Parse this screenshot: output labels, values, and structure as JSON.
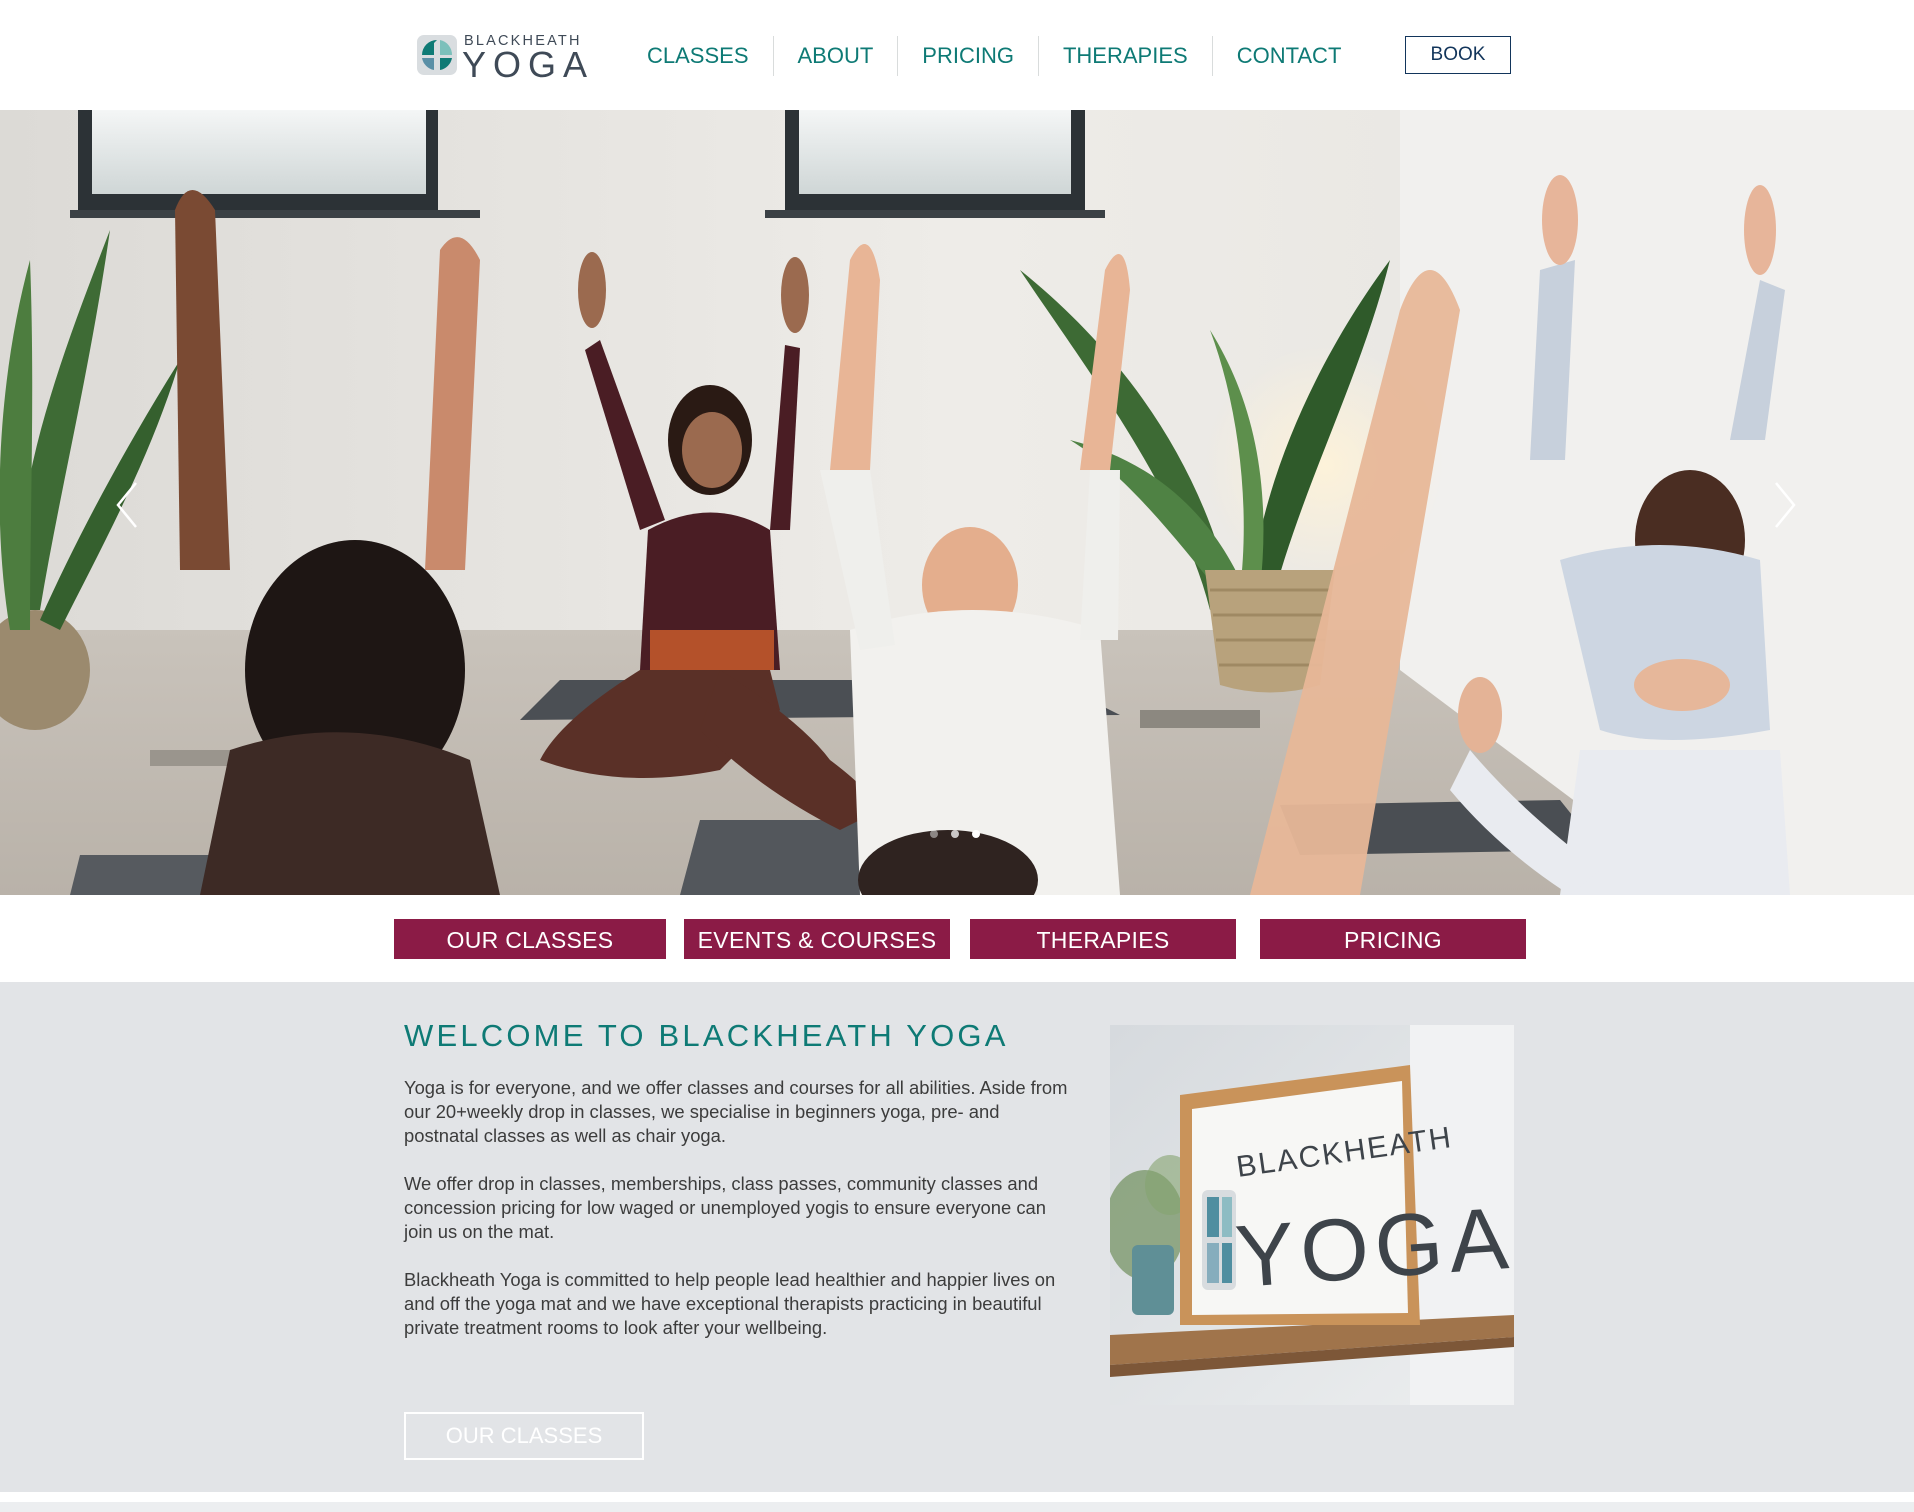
{
  "brand": {
    "name_small": "BLACKHEATH",
    "name_big": "YOGA",
    "colors": {
      "teal": "#0e7a75",
      "navy": "#12355b",
      "berry": "#8b1b46",
      "welcome_bg": "#e2e4e7"
    }
  },
  "nav": {
    "items": [
      {
        "label": "CLASSES"
      },
      {
        "label": "ABOUT"
      },
      {
        "label": "PRICING"
      },
      {
        "label": "THERAPIES"
      },
      {
        "label": "CONTACT"
      }
    ],
    "book_label": "BOOK"
  },
  "hero": {
    "slide_count": 3,
    "active_slide": 3,
    "prev_icon": "chevron-left-icon",
    "next_icon": "chevron-right-icon"
  },
  "cta": {
    "items": [
      {
        "label": "OUR CLASSES"
      },
      {
        "label": "EVENTS & COURSES"
      },
      {
        "label": "THERAPIES"
      },
      {
        "label": "PRICING"
      }
    ]
  },
  "welcome": {
    "title": "WELCOME TO BLACKHEATH YOGA",
    "paragraphs": [
      "Yoga is for everyone, and we offer classes and courses for all abilities. Aside from our 20+weekly drop in classes, we specialise in beginners yoga, pre- and postnatal classes as well as chair yoga.",
      "We offer drop in classes, memberships, class passes, community classes and concession pricing for low waged or unemployed yogis to ensure everyone can join us on the mat.",
      "Blackheath Yoga is committed to help people lead healthier and happier lives on and off the yoga mat and we have exceptional therapists practicing in beautiful private treatment rooms to look after your wellbeing."
    ],
    "button_label": "OUR CLASSES",
    "sign": {
      "small": "BLACKHEATH",
      "big": "YOGA"
    }
  }
}
